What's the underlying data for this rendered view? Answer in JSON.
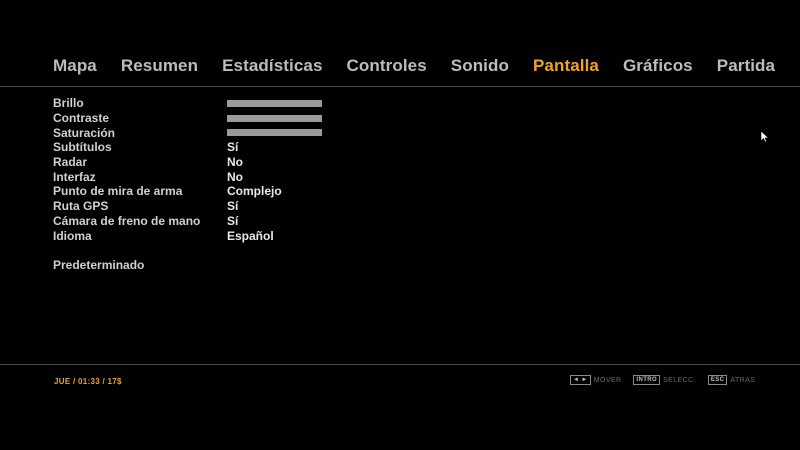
{
  "tabs": [
    {
      "label": "Mapa",
      "active": false
    },
    {
      "label": "Resumen",
      "active": false
    },
    {
      "label": "Estadísticas",
      "active": false
    },
    {
      "label": "Controles",
      "active": false
    },
    {
      "label": "Sonido",
      "active": false
    },
    {
      "label": "Pantalla",
      "active": true
    },
    {
      "label": "Gráficos",
      "active": false
    },
    {
      "label": "Partida",
      "active": false
    }
  ],
  "settings": {
    "brillo": {
      "label": "Brillo",
      "level": 1.0
    },
    "contraste": {
      "label": "Contraste",
      "level": 1.0
    },
    "saturacion": {
      "label": "Saturación",
      "level": 1.0
    },
    "subtitulos": {
      "label": "Subtítulos",
      "value": "Sí"
    },
    "radar": {
      "label": "Radar",
      "value": "No"
    },
    "interfaz": {
      "label": "Interfaz",
      "value": "No"
    },
    "mira": {
      "label": "Punto de mira de arma",
      "value": "Complejo"
    },
    "gps": {
      "label": "Ruta GPS",
      "value": "Sí"
    },
    "camara": {
      "label": "Cámara de freno de mano",
      "value": "Sí"
    },
    "idioma": {
      "label": "Idioma",
      "value": "Español"
    },
    "default_label": "Predeterminado"
  },
  "status": {
    "text": "JUE  /  01:33  /  17$"
  },
  "hints": {
    "move_key": "◄ ►",
    "move_label": "MOVER",
    "select_key": "INTRO",
    "select_label": "SELECC.",
    "back_key": "ESC",
    "back_label": "ATRAS"
  },
  "colors": {
    "accent": "#f0a030",
    "background": "#000000",
    "text": "#c8c8c8"
  },
  "icons": {
    "cursor": "arrow-cursor-icon"
  }
}
